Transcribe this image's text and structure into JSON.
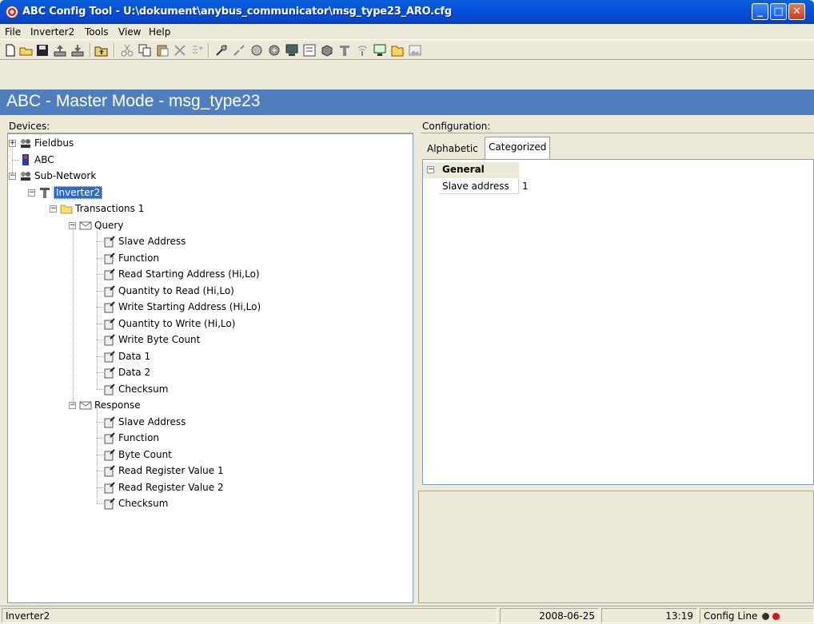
{
  "window": {
    "title": "ABC Config Tool - U:\\dokument\\anybus_communicator\\msg_type23_ARO.cfg"
  },
  "menu": [
    {
      "label": "File",
      "underline": "F"
    },
    {
      "label": "Inverter2",
      "underline": "I"
    },
    {
      "label": "Tools",
      "underline": "T"
    },
    {
      "label": "View",
      "underline": "V"
    },
    {
      "label": "Help",
      "underline": "H"
    }
  ],
  "band": {
    "title": "ABC - Master Mode - msg_type23"
  },
  "devices": {
    "header": "Devices:",
    "tree": {
      "fieldbus": "Fieldbus",
      "abc": "ABC",
      "subnetwork": "Sub-Network",
      "inverter": "Inverter2",
      "transactions": "Transactions 1",
      "query": "Query",
      "query_items": [
        "Slave Address",
        "Function",
        "Read Starting Address (Hi,Lo)",
        "Quantity to Read (Hi,Lo)",
        "Write Starting Address (Hi,Lo)",
        "Quantity to Write (Hi,Lo)",
        "Write Byte Count",
        "Data 1",
        "Data 2",
        "Checksum"
      ],
      "response": "Response",
      "response_items": [
        "Slave Address",
        "Function",
        "Byte Count",
        "Read Register Value 1",
        "Read Register Value 2",
        "Checksum"
      ]
    }
  },
  "configuration": {
    "header": "Configuration:",
    "tabs": [
      {
        "label": "Alphabetic",
        "active": false
      },
      {
        "label": "Categorized",
        "active": true
      }
    ],
    "category": "General",
    "property": {
      "name": "Slave address",
      "value": "1"
    }
  },
  "status": {
    "left": "Inverter2",
    "date": "2008-06-25",
    "time": "13:19",
    "line": "Config Line"
  }
}
